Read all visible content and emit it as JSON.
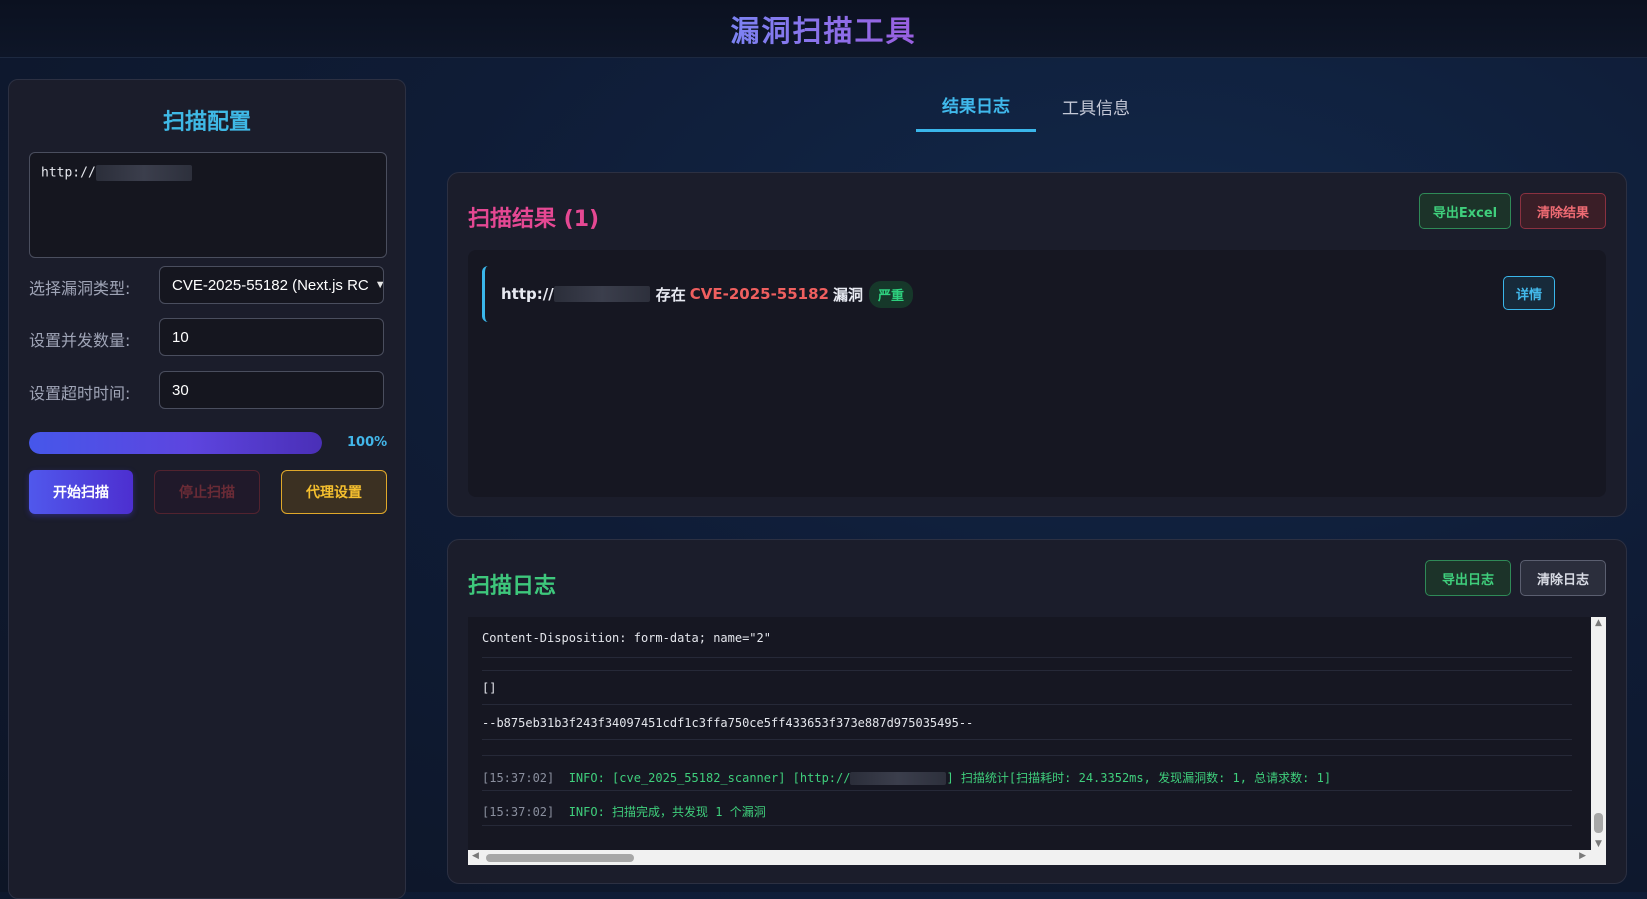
{
  "app": {
    "title": "漏洞扫描工具"
  },
  "config": {
    "title": "扫描配置",
    "url_value": "http://",
    "vuln_type_label": "选择漏洞类型:",
    "vuln_type_selected": "CVE-2025-55182 (Next.js RC",
    "concurrency_label": "设置并发数量:",
    "concurrency_value": "10",
    "timeout_label": "设置超时时间:",
    "timeout_value": "30",
    "progress_percent": 100,
    "progress_text": "100%",
    "start_label": "开始扫描",
    "stop_label": "停止扫描",
    "proxy_label": "代理设置"
  },
  "tabs": [
    {
      "label": "结果日志",
      "active": true
    },
    {
      "label": "工具信息",
      "active": false
    }
  ],
  "results": {
    "title": "扫描结果 (1)",
    "export_label": "导出Excel",
    "clear_label": "清除结果",
    "items": [
      {
        "url": "http://",
        "exists_text": "存在",
        "cve": "CVE-2025-55182",
        "suffix": "漏洞",
        "severity": "严重",
        "detail_label": "详情"
      }
    ]
  },
  "log": {
    "title": "扫描日志",
    "export_label": "导出日志",
    "clear_label": "清除日志",
    "lines": [
      "Content-Disposition: form-data; name=\"2\"",
      "[]",
      "--b875eb31b3f243f34097451cdf1c3ffa750ce5ff433653f373e887d975035495--"
    ],
    "info_lines": [
      {
        "time": "[15:37:02]",
        "prefix": "INFO: [cve_2025_55182_scanner] [http://",
        "rest": "] 扫描统计[扫描耗时: 24.3352ms, 发现漏洞数: 1, 总请求数: 1]"
      },
      {
        "time": "[15:37:02]",
        "prefix": "INFO: 扫描完成，共发现 1 个漏洞",
        "rest": ""
      }
    ]
  },
  "colors": {
    "accent": "#3ab6ea",
    "results_title": "#e54893",
    "log_title": "#3ec77c",
    "cve_red": "#ef5f5f",
    "severity_green": "#2ed07e"
  }
}
